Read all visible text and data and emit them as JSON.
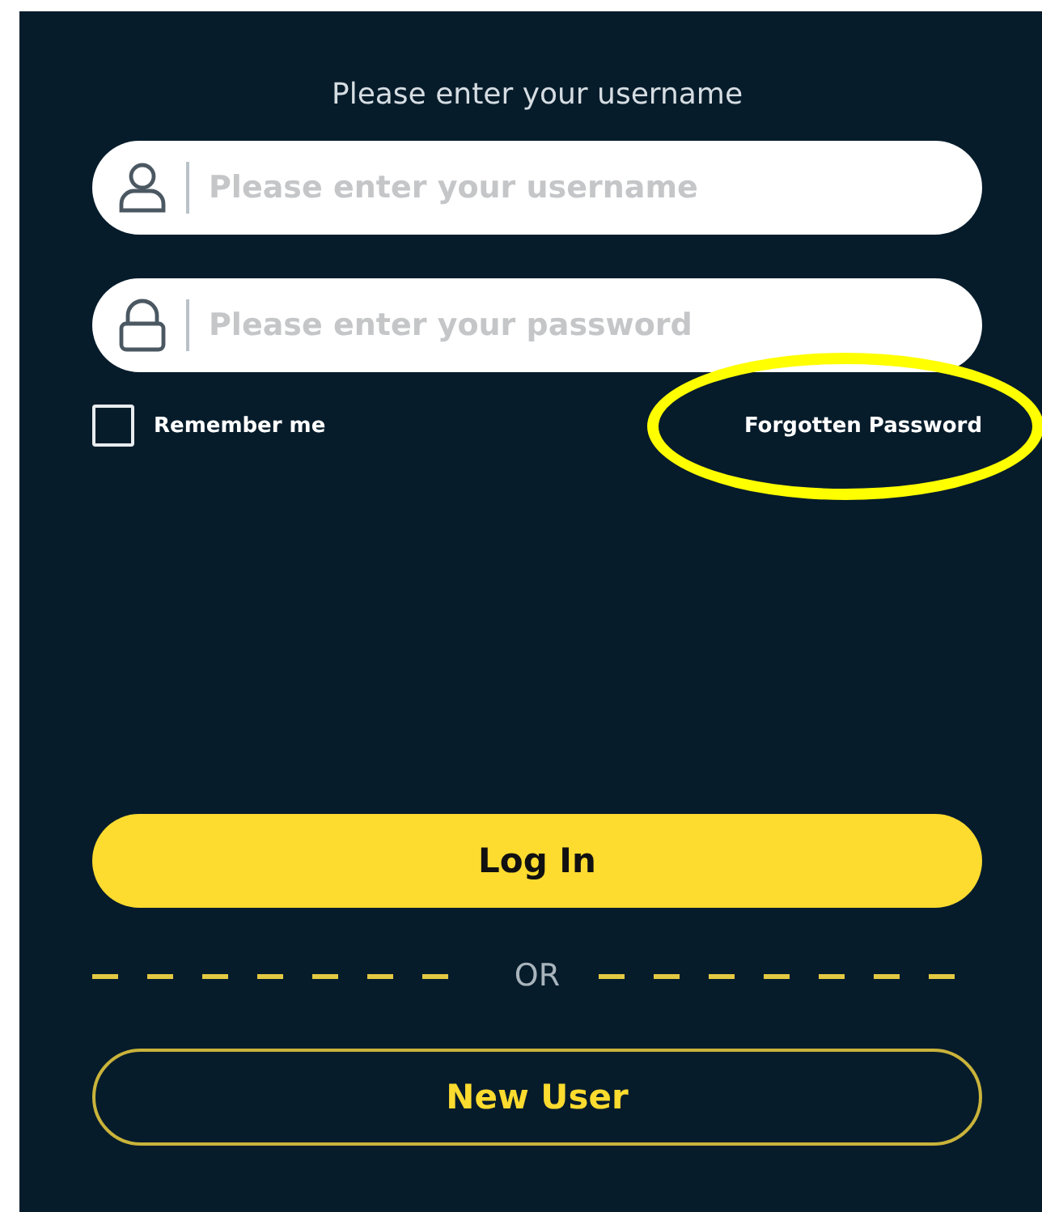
{
  "heading": "Please enter your username",
  "fields": [
    {
      "kind": "username",
      "placeholder": "Please enter your username"
    },
    {
      "kind": "password",
      "placeholder": "Please enter your password"
    }
  ],
  "remember_me": {
    "label": "Remember me",
    "checked": false
  },
  "forgot_password": {
    "label": "Forgotten Password",
    "highlighted": true
  },
  "login_button": "Log In",
  "divider": "OR",
  "new_user_button": "New User"
}
